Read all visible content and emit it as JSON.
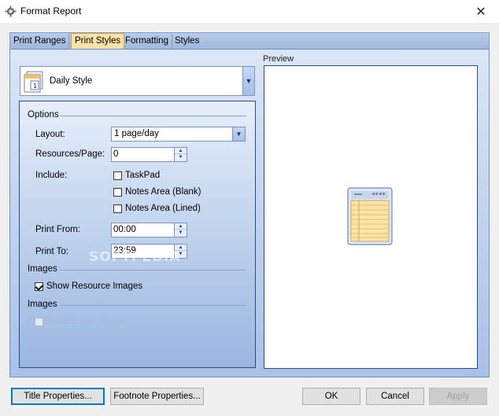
{
  "window": {
    "title": "Format Report",
    "close_glyph": "✕",
    "icon": "gear-icon"
  },
  "tabs": [
    {
      "label": "Print Ranges",
      "active": false
    },
    {
      "label": "Print Styles",
      "active": true
    },
    {
      "label": "Formatting",
      "active": false
    },
    {
      "label": "Styles",
      "active": false
    }
  ],
  "style_selector": {
    "value": "Daily Style",
    "icon": "calendar-icon"
  },
  "options": {
    "heading": "Options",
    "layout_label": "Layout:",
    "layout_value": "1 page/day",
    "resources_label": "Resources/Page:",
    "resources_value": "0",
    "include_label": "Include:",
    "include_items": [
      {
        "label": "TaskPad",
        "checked": false
      },
      {
        "label": "Notes Area (Blank)",
        "checked": false
      },
      {
        "label": "Notes Area (Lined)",
        "checked": false
      }
    ],
    "print_from_label": "Print From:",
    "print_from_value": "00:00",
    "print_to_label": "Print To:",
    "print_to_value": "23:59",
    "images_heading_1": "Images",
    "show_resource_images": {
      "label": "Show Resource Images",
      "checked": true
    },
    "images_heading_2": "Images",
    "show_event_images": {
      "label": "Show Event Images",
      "checked": false,
      "disabled": true
    }
  },
  "preview": {
    "label": "Preview",
    "icon": "document-preview-icon"
  },
  "buttons": {
    "title_properties": "Title Properties...",
    "footnote_properties": "Footnote Properties...",
    "ok": "OK",
    "cancel": "Cancel",
    "apply": "Apply"
  },
  "watermark": "SOFTPEDIA",
  "colors": {
    "tab_active": "#fbe3a8",
    "panel_top": "#dbe6f6",
    "panel_bottom": "#a9c1e6",
    "border_blue": "#284c8a"
  }
}
